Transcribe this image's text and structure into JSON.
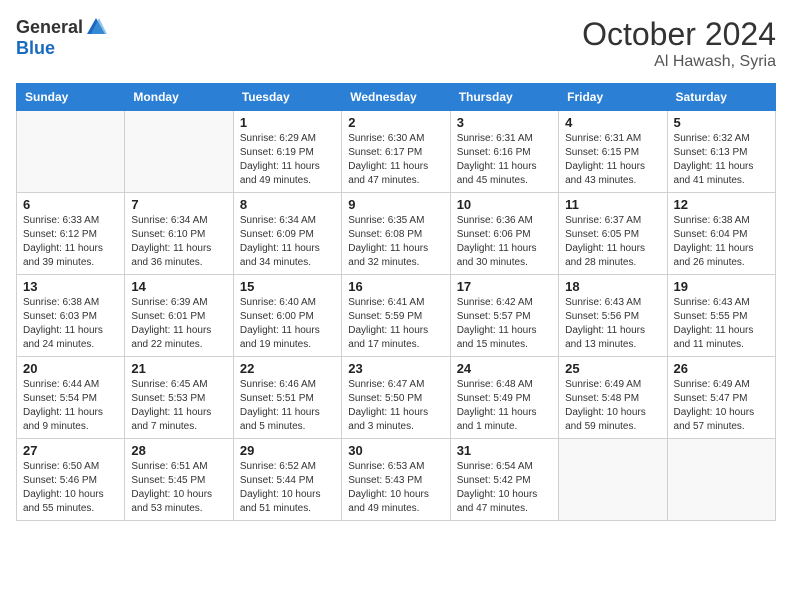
{
  "header": {
    "logo_general": "General",
    "logo_blue": "Blue",
    "month_title": "October 2024",
    "location": "Al Hawash, Syria"
  },
  "weekdays": [
    "Sunday",
    "Monday",
    "Tuesday",
    "Wednesday",
    "Thursday",
    "Friday",
    "Saturday"
  ],
  "weeks": [
    [
      {
        "day": "",
        "sunrise": "",
        "sunset": "",
        "daylight": ""
      },
      {
        "day": "",
        "sunrise": "",
        "sunset": "",
        "daylight": ""
      },
      {
        "day": "1",
        "sunrise": "Sunrise: 6:29 AM",
        "sunset": "Sunset: 6:19 PM",
        "daylight": "Daylight: 11 hours and 49 minutes."
      },
      {
        "day": "2",
        "sunrise": "Sunrise: 6:30 AM",
        "sunset": "Sunset: 6:17 PM",
        "daylight": "Daylight: 11 hours and 47 minutes."
      },
      {
        "day": "3",
        "sunrise": "Sunrise: 6:31 AM",
        "sunset": "Sunset: 6:16 PM",
        "daylight": "Daylight: 11 hours and 45 minutes."
      },
      {
        "day": "4",
        "sunrise": "Sunrise: 6:31 AM",
        "sunset": "Sunset: 6:15 PM",
        "daylight": "Daylight: 11 hours and 43 minutes."
      },
      {
        "day": "5",
        "sunrise": "Sunrise: 6:32 AM",
        "sunset": "Sunset: 6:13 PM",
        "daylight": "Daylight: 11 hours and 41 minutes."
      }
    ],
    [
      {
        "day": "6",
        "sunrise": "Sunrise: 6:33 AM",
        "sunset": "Sunset: 6:12 PM",
        "daylight": "Daylight: 11 hours and 39 minutes."
      },
      {
        "day": "7",
        "sunrise": "Sunrise: 6:34 AM",
        "sunset": "Sunset: 6:10 PM",
        "daylight": "Daylight: 11 hours and 36 minutes."
      },
      {
        "day": "8",
        "sunrise": "Sunrise: 6:34 AM",
        "sunset": "Sunset: 6:09 PM",
        "daylight": "Daylight: 11 hours and 34 minutes."
      },
      {
        "day": "9",
        "sunrise": "Sunrise: 6:35 AM",
        "sunset": "Sunset: 6:08 PM",
        "daylight": "Daylight: 11 hours and 32 minutes."
      },
      {
        "day": "10",
        "sunrise": "Sunrise: 6:36 AM",
        "sunset": "Sunset: 6:06 PM",
        "daylight": "Daylight: 11 hours and 30 minutes."
      },
      {
        "day": "11",
        "sunrise": "Sunrise: 6:37 AM",
        "sunset": "Sunset: 6:05 PM",
        "daylight": "Daylight: 11 hours and 28 minutes."
      },
      {
        "day": "12",
        "sunrise": "Sunrise: 6:38 AM",
        "sunset": "Sunset: 6:04 PM",
        "daylight": "Daylight: 11 hours and 26 minutes."
      }
    ],
    [
      {
        "day": "13",
        "sunrise": "Sunrise: 6:38 AM",
        "sunset": "Sunset: 6:03 PM",
        "daylight": "Daylight: 11 hours and 24 minutes."
      },
      {
        "day": "14",
        "sunrise": "Sunrise: 6:39 AM",
        "sunset": "Sunset: 6:01 PM",
        "daylight": "Daylight: 11 hours and 22 minutes."
      },
      {
        "day": "15",
        "sunrise": "Sunrise: 6:40 AM",
        "sunset": "Sunset: 6:00 PM",
        "daylight": "Daylight: 11 hours and 19 minutes."
      },
      {
        "day": "16",
        "sunrise": "Sunrise: 6:41 AM",
        "sunset": "Sunset: 5:59 PM",
        "daylight": "Daylight: 11 hours and 17 minutes."
      },
      {
        "day": "17",
        "sunrise": "Sunrise: 6:42 AM",
        "sunset": "Sunset: 5:57 PM",
        "daylight": "Daylight: 11 hours and 15 minutes."
      },
      {
        "day": "18",
        "sunrise": "Sunrise: 6:43 AM",
        "sunset": "Sunset: 5:56 PM",
        "daylight": "Daylight: 11 hours and 13 minutes."
      },
      {
        "day": "19",
        "sunrise": "Sunrise: 6:43 AM",
        "sunset": "Sunset: 5:55 PM",
        "daylight": "Daylight: 11 hours and 11 minutes."
      }
    ],
    [
      {
        "day": "20",
        "sunrise": "Sunrise: 6:44 AM",
        "sunset": "Sunset: 5:54 PM",
        "daylight": "Daylight: 11 hours and 9 minutes."
      },
      {
        "day": "21",
        "sunrise": "Sunrise: 6:45 AM",
        "sunset": "Sunset: 5:53 PM",
        "daylight": "Daylight: 11 hours and 7 minutes."
      },
      {
        "day": "22",
        "sunrise": "Sunrise: 6:46 AM",
        "sunset": "Sunset: 5:51 PM",
        "daylight": "Daylight: 11 hours and 5 minutes."
      },
      {
        "day": "23",
        "sunrise": "Sunrise: 6:47 AM",
        "sunset": "Sunset: 5:50 PM",
        "daylight": "Daylight: 11 hours and 3 minutes."
      },
      {
        "day": "24",
        "sunrise": "Sunrise: 6:48 AM",
        "sunset": "Sunset: 5:49 PM",
        "daylight": "Daylight: 11 hours and 1 minute."
      },
      {
        "day": "25",
        "sunrise": "Sunrise: 6:49 AM",
        "sunset": "Sunset: 5:48 PM",
        "daylight": "Daylight: 10 hours and 59 minutes."
      },
      {
        "day": "26",
        "sunrise": "Sunrise: 6:49 AM",
        "sunset": "Sunset: 5:47 PM",
        "daylight": "Daylight: 10 hours and 57 minutes."
      }
    ],
    [
      {
        "day": "27",
        "sunrise": "Sunrise: 6:50 AM",
        "sunset": "Sunset: 5:46 PM",
        "daylight": "Daylight: 10 hours and 55 minutes."
      },
      {
        "day": "28",
        "sunrise": "Sunrise: 6:51 AM",
        "sunset": "Sunset: 5:45 PM",
        "daylight": "Daylight: 10 hours and 53 minutes."
      },
      {
        "day": "29",
        "sunrise": "Sunrise: 6:52 AM",
        "sunset": "Sunset: 5:44 PM",
        "daylight": "Daylight: 10 hours and 51 minutes."
      },
      {
        "day": "30",
        "sunrise": "Sunrise: 6:53 AM",
        "sunset": "Sunset: 5:43 PM",
        "daylight": "Daylight: 10 hours and 49 minutes."
      },
      {
        "day": "31",
        "sunrise": "Sunrise: 6:54 AM",
        "sunset": "Sunset: 5:42 PM",
        "daylight": "Daylight: 10 hours and 47 minutes."
      },
      {
        "day": "",
        "sunrise": "",
        "sunset": "",
        "daylight": ""
      },
      {
        "day": "",
        "sunrise": "",
        "sunset": "",
        "daylight": ""
      }
    ]
  ]
}
